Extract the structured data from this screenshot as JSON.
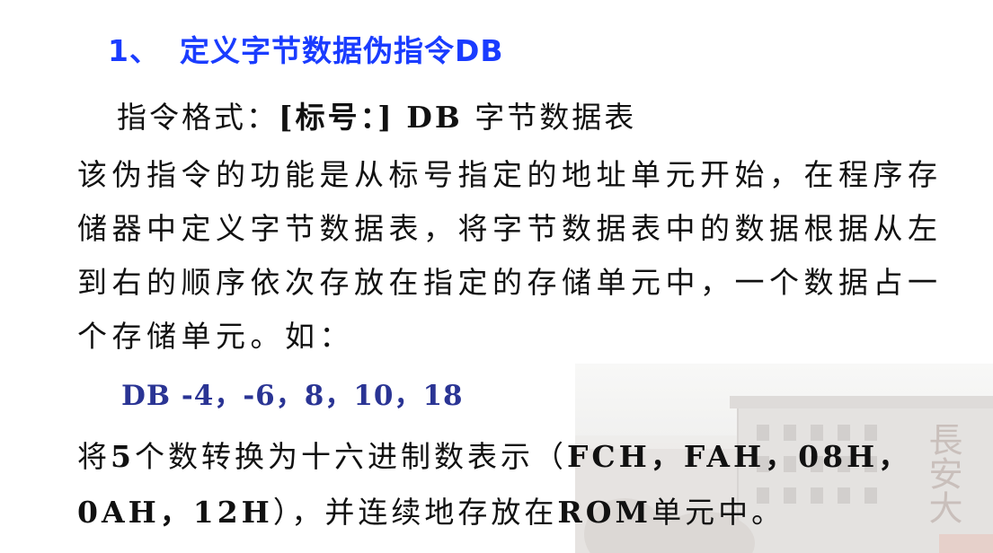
{
  "heading": {
    "number": "1、",
    "title": "定义字节数据伪指令DB"
  },
  "format": {
    "prefix": "指令格式：",
    "label_part": "[标号：]",
    "keyword": "DB",
    "operand": "字节数据表"
  },
  "description": {
    "lines": [
      "该伪指令的功能是从标号指定的地址单元开始，在程序存",
      "储器中定义字节数据表，将字节数据表中的数据根据从左",
      "到右的顺序依次存放在指定的存储单元中，一个数据占一",
      "个存储单元。如："
    ]
  },
  "example": {
    "code": "DB -4，-6，8，10，18"
  },
  "conversion": {
    "line1_a": "将",
    "line1_count": "5",
    "line1_b": "个数转换为十六进制数表示（",
    "line1_hex": "FCH，FAH，08H，",
    "line2_hex": "0AH，12H",
    "line2_a": "），并连续地存放在",
    "line2_rom": "ROM",
    "line2_b": "单元中。"
  },
  "background": {
    "calligraphy": "長安大"
  },
  "colors": {
    "heading": "#1a3cff",
    "example": "#2a3494",
    "text": "#111111"
  }
}
